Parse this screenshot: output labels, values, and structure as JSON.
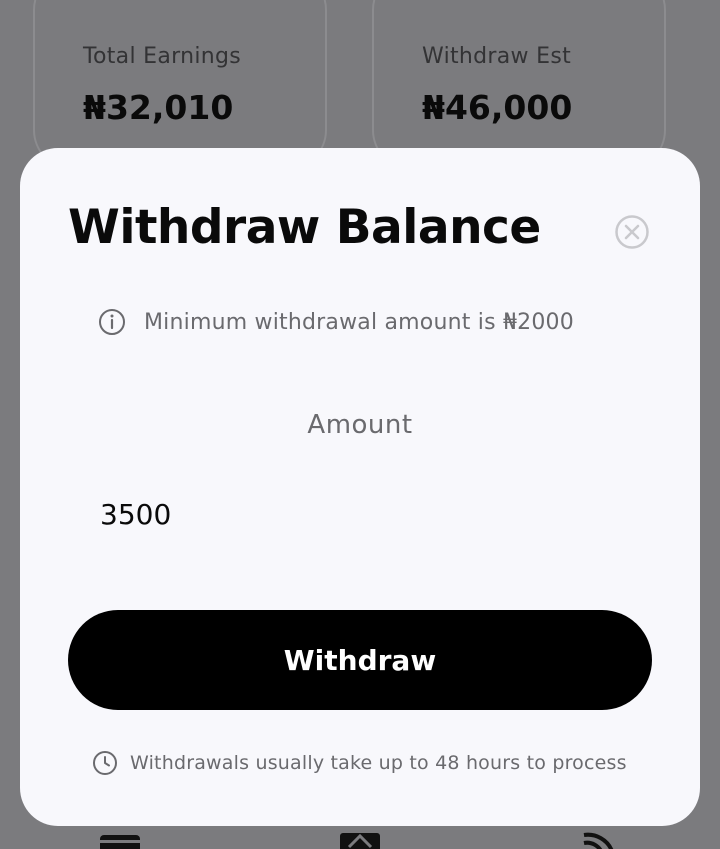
{
  "stats": {
    "total_earnings_label": "Total Earnings",
    "total_earnings_value": "₦32,010",
    "withdraw_est_label": "Withdraw Est",
    "withdraw_est_value": "₦46,000"
  },
  "modal": {
    "title": "Withdraw Balance",
    "close_icon": "close-circle-icon",
    "min_note": "Minimum withdrawal amount is ₦2000",
    "amount_label": "Amount",
    "amount_value": "3500",
    "withdraw_label": "Withdraw",
    "process_note": "Withdrawals usually take up to 48 hours to process"
  },
  "nav": {
    "icons": [
      "wallet-icon",
      "stats-icon",
      "feed-icon"
    ]
  },
  "colors": {
    "overlay": "#7b7b7e",
    "modal_bg": "#f8f8fc",
    "primary": "#000000",
    "muted_text": "#6a6a6e"
  }
}
